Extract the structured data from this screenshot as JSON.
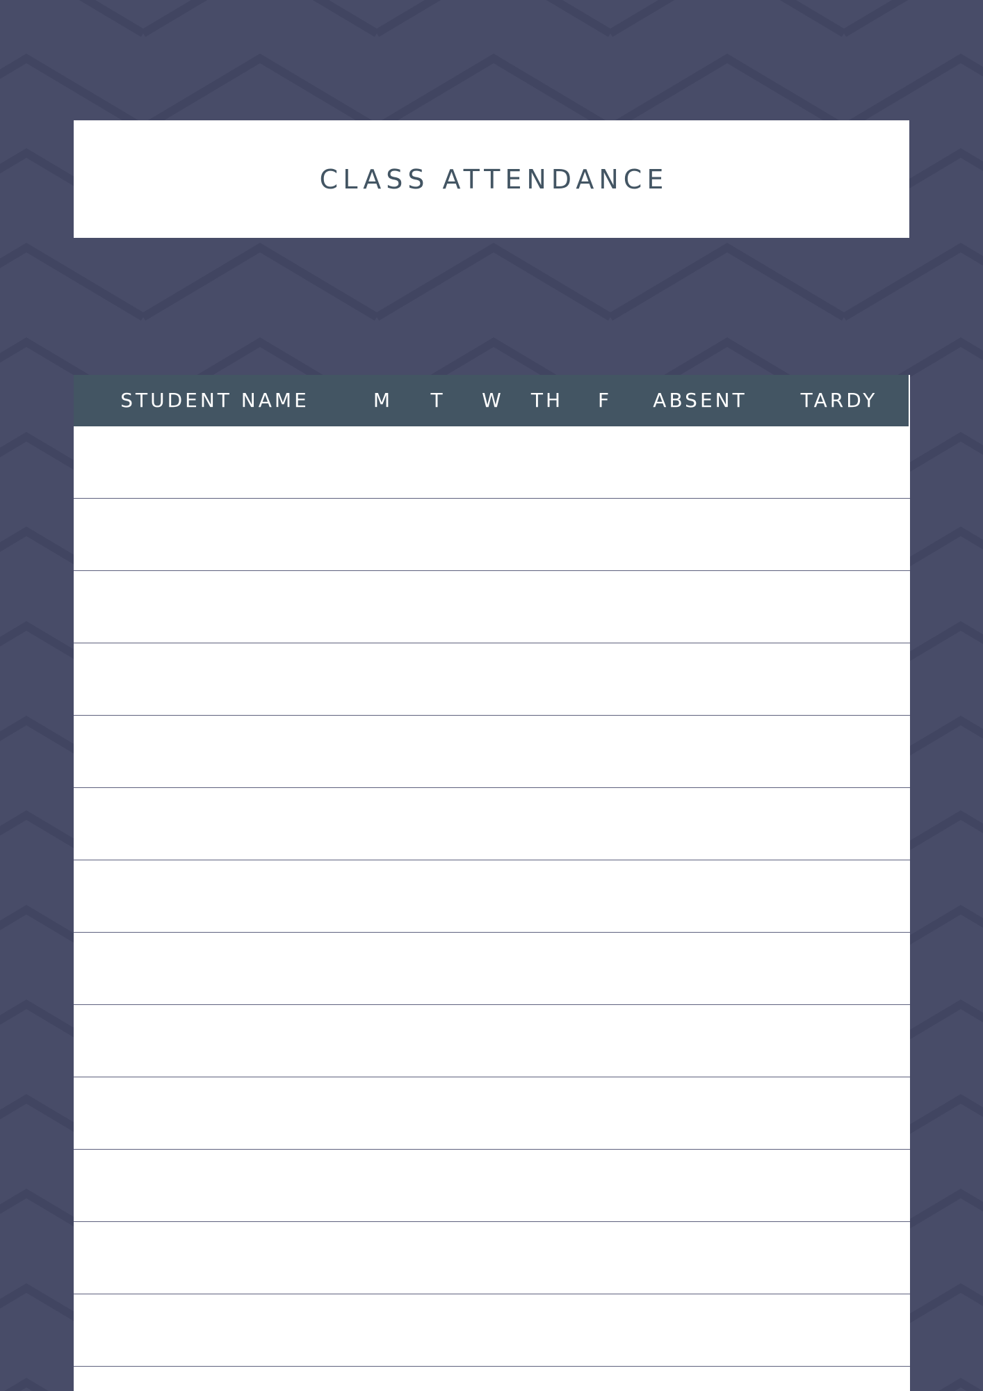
{
  "title": "CLASS ATTENDANCE",
  "columns": [
    "STUDENT NAME",
    "M",
    "T",
    "W",
    "TH",
    "F",
    "ABSENT",
    "TARDY"
  ],
  "row_count": 14,
  "colors": {
    "background": "#484c68",
    "pattern": "#414561",
    "header": "#435563",
    "title_text": "#435563",
    "row_line": "#5c5f7c"
  }
}
